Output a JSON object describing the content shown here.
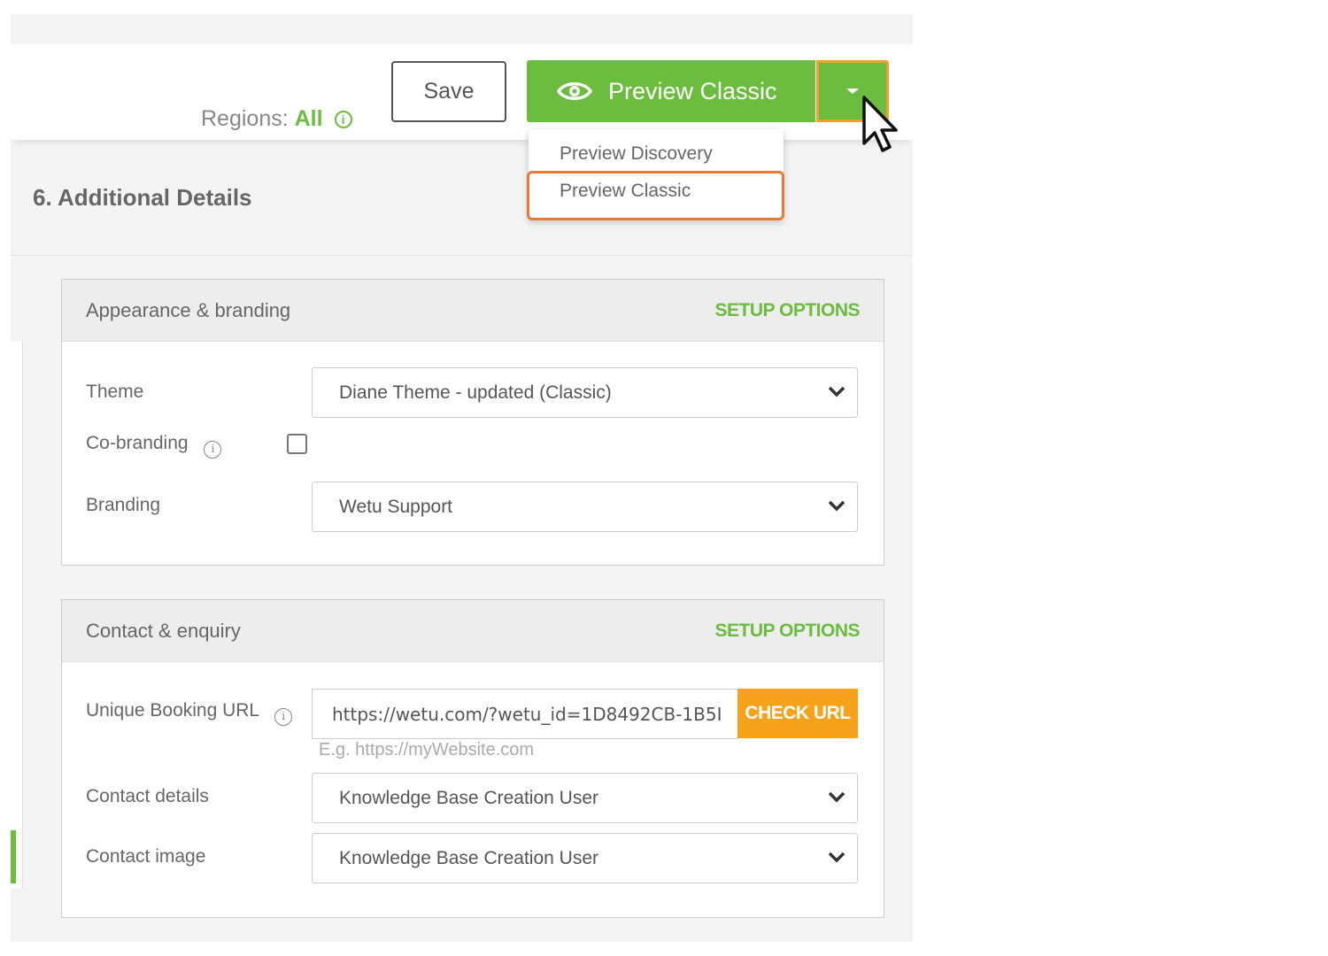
{
  "toolbar": {
    "regions_label": "Regions:",
    "regions_value": "All",
    "save_label": "Save",
    "preview_label": "Preview Classic"
  },
  "dropdown": {
    "items": [
      "Preview Discovery",
      "Preview Classic"
    ],
    "highlighted": "Preview Classic"
  },
  "section": {
    "title": "6. Additional Details"
  },
  "appearance": {
    "title": "Appearance & branding",
    "setup_label": "SETUP OPTIONS",
    "theme_label": "Theme",
    "theme_value": "Diane Theme - updated (Classic)",
    "cobranding_label": "Co-branding",
    "cobranding_checked": false,
    "branding_label": "Branding",
    "branding_value": "Wetu Support"
  },
  "contact": {
    "title": "Contact & enquiry",
    "setup_label": "SETUP OPTIONS",
    "booking_url_label": "Unique Booking URL",
    "booking_url_value": "https://wetu.com/?wetu_id=1D8492CB-1B5I",
    "check_url_label": "CHECK URL",
    "booking_url_hint": "E.g. https://myWebsite.com",
    "contact_details_label": "Contact details",
    "contact_details_value": "Knowledge Base Creation User",
    "contact_image_label": "Contact image",
    "contact_image_value": "Knowledge Base Creation User"
  },
  "colors": {
    "accent_green": "#6cbd3f",
    "accent_orange": "#f7a21b",
    "highlight_orange": "#e57a3a"
  },
  "icons": [
    "info-icon",
    "eye-icon",
    "caret-down-icon",
    "chevron-down-icon",
    "mouse-cursor-icon"
  ]
}
